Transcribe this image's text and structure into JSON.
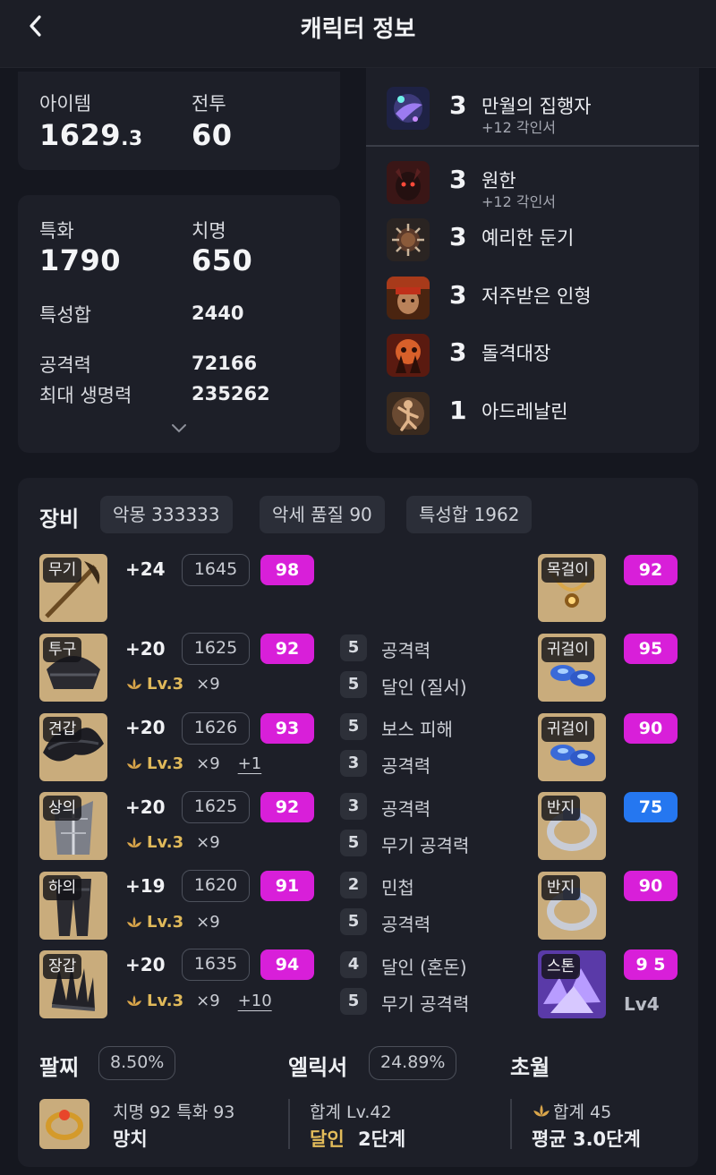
{
  "header": {
    "title": "캐릭터 정보",
    "back_icon": "chevron-left-icon"
  },
  "summary": {
    "item_label": "아이템",
    "item_value_main": "1629",
    "item_value_decimal": ".3",
    "combat_label": "전투",
    "combat_value": "60"
  },
  "stats": {
    "spec_label": "특화",
    "spec_value": "1790",
    "crit_label": "치명",
    "crit_value": "650",
    "trait_sum_label": "특성합",
    "trait_sum_value": "2440",
    "attack_label": "공격력",
    "attack_value": "72166",
    "hp_label": "최대 생명력",
    "hp_value": "235262",
    "expand_icon": "chevron-down-icon"
  },
  "engravings": [
    {
      "level": "3",
      "name": "만월의 집행자",
      "sub": "+12 각인서",
      "icon": "moon-executor-icon"
    },
    {
      "level": "3",
      "name": "원한",
      "sub": "+12 각인서",
      "icon": "grudge-icon"
    },
    {
      "level": "3",
      "name": "예리한 둔기",
      "sub": "",
      "icon": "keen-blunt-icon"
    },
    {
      "level": "3",
      "name": "저주받은 인형",
      "sub": "",
      "icon": "cursed-doll-icon"
    },
    {
      "level": "3",
      "name": "돌격대장",
      "sub": "",
      "icon": "raid-captain-icon"
    },
    {
      "level": "1",
      "name": "아드레날린",
      "sub": "",
      "icon": "adrenaline-icon"
    }
  ],
  "equipment": {
    "title": "장비",
    "pills": [
      "악몽 333333",
      "악세 품질 90",
      "특성합 1962"
    ],
    "armor": [
      {
        "slot": "무기",
        "enh": "+24",
        "ilvl": "1645",
        "quality": "98",
        "lv": "",
        "mult": "",
        "plus": ""
      },
      {
        "slot": "투구",
        "enh": "+20",
        "ilvl": "1625",
        "quality": "92",
        "lv": "Lv.3",
        "mult": "×9",
        "plus": ""
      },
      {
        "slot": "견갑",
        "enh": "+20",
        "ilvl": "1626",
        "quality": "93",
        "lv": "Lv.3",
        "mult": "×9",
        "plus": "+1"
      },
      {
        "slot": "상의",
        "enh": "+20",
        "ilvl": "1625",
        "quality": "92",
        "lv": "Lv.3",
        "mult": "×9",
        "plus": ""
      },
      {
        "slot": "하의",
        "enh": "+19",
        "ilvl": "1620",
        "quality": "91",
        "lv": "Lv.3",
        "mult": "×9",
        "plus": ""
      },
      {
        "slot": "장갑",
        "enh": "+20",
        "ilvl": "1635",
        "quality": "94",
        "lv": "Lv.3",
        "mult": "×9",
        "plus": "+10"
      }
    ],
    "effects": [
      {
        "num": "5",
        "name": "공격력"
      },
      {
        "num": "5",
        "name": "달인 (질서)"
      },
      {
        "num": "5",
        "name": "보스 피해"
      },
      {
        "num": "3",
        "name": "공격력"
      },
      {
        "num": "3",
        "name": "공격력"
      },
      {
        "num": "5",
        "name": "무기 공격력"
      },
      {
        "num": "2",
        "name": "민첩"
      },
      {
        "num": "5",
        "name": "공격력"
      },
      {
        "num": "4",
        "name": "달인 (혼돈)"
      },
      {
        "num": "5",
        "name": "무기 공격력"
      }
    ],
    "accessories": [
      {
        "slot": "목걸이",
        "quality": "92",
        "color": "#d81fd9"
      },
      {
        "slot": "귀걸이",
        "quality": "95",
        "color": "#d81fd9"
      },
      {
        "slot": "귀걸이",
        "quality": "90",
        "color": "#d81fd9"
      },
      {
        "slot": "반지",
        "quality": "75",
        "color": "#2577f0"
      },
      {
        "slot": "반지",
        "quality": "90",
        "color": "#d81fd9"
      },
      {
        "slot": "스톤",
        "quality": "9 5",
        "color": "#d81fd9",
        "level": "Lv4"
      }
    ]
  },
  "bottom": {
    "bracelet_title": "팔찌",
    "bracelet_pct": "8.50%",
    "elixir_title": "엘릭서",
    "elixir_pct": "24.89%",
    "transcend_title": "초월",
    "bracelet_stats": "치명 92  특화 93",
    "bracelet_name": "망치",
    "elixir_total": "합계 Lv.42",
    "elixir_set": "달인",
    "elixir_stage": "2단계",
    "transcend_total": "합계 45",
    "transcend_avg": "평균 3.0단계"
  }
}
